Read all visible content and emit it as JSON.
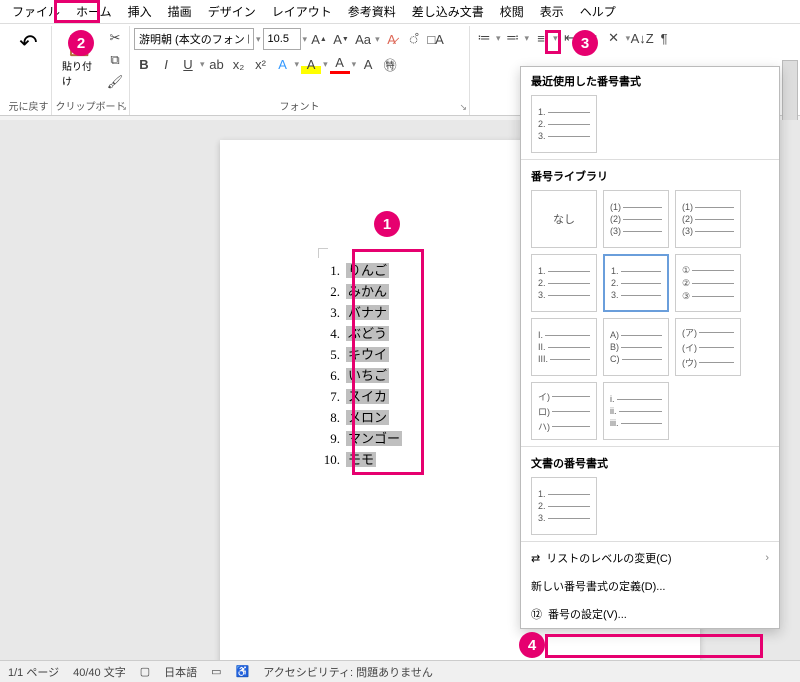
{
  "menubar": [
    "ファイル",
    "ホーム",
    "挿入",
    "描画",
    "デザイン",
    "レイアウト",
    "参考資料",
    "差し込み文書",
    "校閲",
    "表示",
    "ヘルプ"
  ],
  "active_tab_index": 1,
  "ribbon": {
    "undo": {
      "label": "元に戻す"
    },
    "clipboard": {
      "label": "クリップボード",
      "paste": "貼り付け"
    },
    "font": {
      "label": "フォント",
      "name": "游明朝 (本文のフォント",
      "size": "10.5"
    }
  },
  "list_items": [
    "りんご",
    "みかん",
    "バナナ",
    "ぶどう",
    "キウイ",
    "いちご",
    "スイカ",
    "メロン",
    "マンゴー",
    "モモ"
  ],
  "num_panel": {
    "recent_title": "最近使用した番号書式",
    "recent": [
      [
        "1.",
        "2.",
        "3."
      ]
    ],
    "library_title": "番号ライブラリ",
    "library": [
      {
        "type": "none",
        "label": "なし"
      },
      {
        "lines": [
          "(1)",
          "(2)",
          "(3)"
        ]
      },
      {
        "lines": [
          "(1)",
          "(2)",
          "(3)"
        ]
      },
      {
        "lines": [
          "1.",
          "2.",
          "3."
        ]
      },
      {
        "lines": [
          "1.",
          "2.",
          "3."
        ],
        "selected": true
      },
      {
        "lines": [
          "①",
          "②",
          "③"
        ]
      },
      {
        "lines": [
          "I.",
          "II.",
          "III."
        ]
      },
      {
        "lines": [
          "A)",
          "B)",
          "C)"
        ]
      },
      {
        "lines": [
          "(ア)",
          "(イ)",
          "(ウ)"
        ]
      },
      {
        "lines": [
          "イ)",
          "ロ)",
          "ハ)"
        ]
      },
      {
        "lines": [
          "i.",
          "ii.",
          "iii."
        ]
      }
    ],
    "doc_title": "文書の番号書式",
    "doc": [
      {
        "lines": [
          "1.",
          "2.",
          "3."
        ]
      }
    ],
    "menu_change_level": "リストのレベルの変更(C)",
    "menu_define_new": "新しい番号書式の定義(D)...",
    "menu_set_value": "番号の設定(V)..."
  },
  "statusbar": {
    "page": "1/1 ページ",
    "words": "40/40 文字",
    "lang": "日本語",
    "accessibility": "アクセシビリティ: 問題ありません"
  }
}
